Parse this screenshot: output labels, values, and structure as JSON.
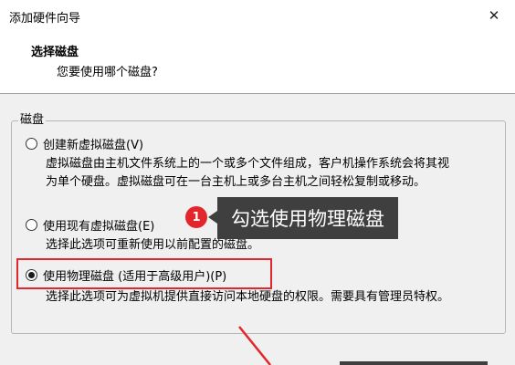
{
  "window": {
    "title": "添加硬件向导",
    "close_symbol": "✕"
  },
  "header": {
    "title": "选择磁盘",
    "subtitle": "您要使用哪个磁盘?"
  },
  "group": {
    "legend": "磁盘",
    "options": [
      {
        "label": "创建新虚拟磁盘(V)",
        "checked": false,
        "description": [
          "虚拟磁盘由主机文件系统上的一个或多个文件组成，客户机操作系统会将其视",
          "为单个硬盘。虚拟磁盘可在一台主机上或多台主机之间轻松复制或移动。"
        ]
      },
      {
        "label": "使用现有虚拟磁盘(E)",
        "checked": false,
        "description": [
          "选择此选项可重新使用以前配置的磁盘。"
        ]
      },
      {
        "label": "使用物理磁盘 (适用于高级用户)(P)",
        "checked": true,
        "description": [
          "选择此选项可为虚拟机提供直接访问本地硬盘的权限。需要具有管理员特权。"
        ]
      }
    ]
  },
  "annotation": {
    "badge": "1",
    "callout_text": "勾选使用物理磁盘",
    "accent_color": "#e3262b"
  }
}
